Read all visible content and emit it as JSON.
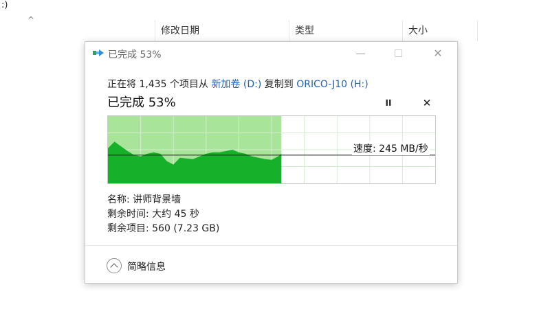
{
  "background": {
    "top_fragment": ":)",
    "columns": [
      {
        "label": "修改日期"
      },
      {
        "label": "类型"
      },
      {
        "label": "大小"
      }
    ]
  },
  "dialog": {
    "title": "已完成 53%",
    "copy_line": {
      "prefix": "正在将 1,435 个项目从 ",
      "source": "新加卷 (D:)",
      "middle": " 复制到 ",
      "destination": "ORICO-J10 (H:)"
    },
    "status": "已完成 53%",
    "pause_icon": "pause-icon",
    "cancel_icon": "close-icon",
    "speed_label": "速度: 245 MB/秒",
    "details": {
      "name": "名称: 讲师背景墙",
      "time_remaining": "剩余时间: 大约 45 秒",
      "items_remaining": "剩余项目: 560 (7.23 GB)"
    },
    "footer_label": "简略信息"
  },
  "colors": {
    "fill_light": "#a8e49a",
    "fill_dark": "#16b02a",
    "link": "#1f5fbf",
    "grid": "#d6ecd2"
  },
  "chart_data": {
    "type": "area",
    "progress": 0.53,
    "current_speed": 245,
    "speed_units": "MB/秒",
    "ylim": [
      0,
      1
    ],
    "x": [
      0,
      0.02,
      0.04,
      0.06,
      0.08,
      0.1,
      0.12,
      0.14,
      0.16,
      0.18,
      0.2,
      0.22,
      0.24,
      0.26,
      0.28,
      0.3,
      0.32,
      0.34,
      0.36,
      0.38,
      0.4,
      0.42,
      0.44,
      0.46,
      0.48,
      0.5,
      0.52,
      0.53
    ],
    "y": [
      0.52,
      0.62,
      0.55,
      0.48,
      0.42,
      0.4,
      0.44,
      0.46,
      0.44,
      0.33,
      0.28,
      0.38,
      0.37,
      0.36,
      0.4,
      0.44,
      0.46,
      0.46,
      0.48,
      0.5,
      0.46,
      0.44,
      0.4,
      0.38,
      0.36,
      0.35,
      0.4,
      0.44
    ],
    "speed_line_y": 0.42
  }
}
